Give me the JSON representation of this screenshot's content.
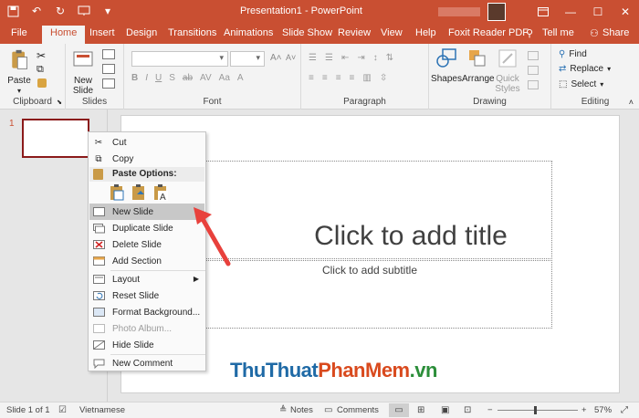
{
  "window": {
    "title": "Presentation1  -  PowerPoint"
  },
  "tabs": [
    {
      "label": "File"
    },
    {
      "label": "Home"
    },
    {
      "label": "Insert"
    },
    {
      "label": "Design"
    },
    {
      "label": "Transitions"
    },
    {
      "label": "Animations"
    },
    {
      "label": "Slide Show"
    },
    {
      "label": "Review"
    },
    {
      "label": "View"
    },
    {
      "label": "Help"
    },
    {
      "label": "Foxit Reader PDF"
    },
    {
      "label": "Tell me"
    },
    {
      "label": "Share"
    }
  ],
  "ribbon": {
    "clipboard": {
      "label": "Clipboard",
      "paste": "Paste"
    },
    "slides": {
      "label": "Slides",
      "new_slide_l1": "New",
      "new_slide_l2": "Slide"
    },
    "font": {
      "label": "Font"
    },
    "paragraph": {
      "label": "Paragraph"
    },
    "drawing": {
      "label": "Drawing",
      "shapes": "Shapes",
      "arrange": "Arrange",
      "quick_l1": "Quick",
      "quick_l2": "Styles"
    },
    "editing": {
      "label": "Editing",
      "find": "Find",
      "replace": "Replace",
      "select": "Select"
    }
  },
  "slide_panel": {
    "number": "1"
  },
  "slide": {
    "title_placeholder": "Click to add title",
    "subtitle_placeholder": "Click to add subtitle"
  },
  "context_menu": {
    "cut": "Cut",
    "copy": "Copy",
    "paste_options": "Paste Options:",
    "new_slide": "New Slide",
    "duplicate_slide": "Duplicate Slide",
    "delete_slide": "Delete Slide",
    "add_section": "Add Section",
    "layout": "Layout",
    "reset_slide": "Reset Slide",
    "format_background": "Format Background...",
    "photo_album": "Photo Album...",
    "hide_slide": "Hide Slide",
    "new_comment": "New Comment"
  },
  "watermark": {
    "part1": "ThuThuat",
    "part2": "PhanMem",
    "part3": ".vn"
  },
  "status_bar": {
    "slide_info": "Slide 1 of 1",
    "language": "Vietnamese",
    "notes": "Notes",
    "comments": "Comments",
    "zoom": "57%"
  },
  "colors": {
    "accent": "#c94f32",
    "arrow": "#e8413c"
  }
}
